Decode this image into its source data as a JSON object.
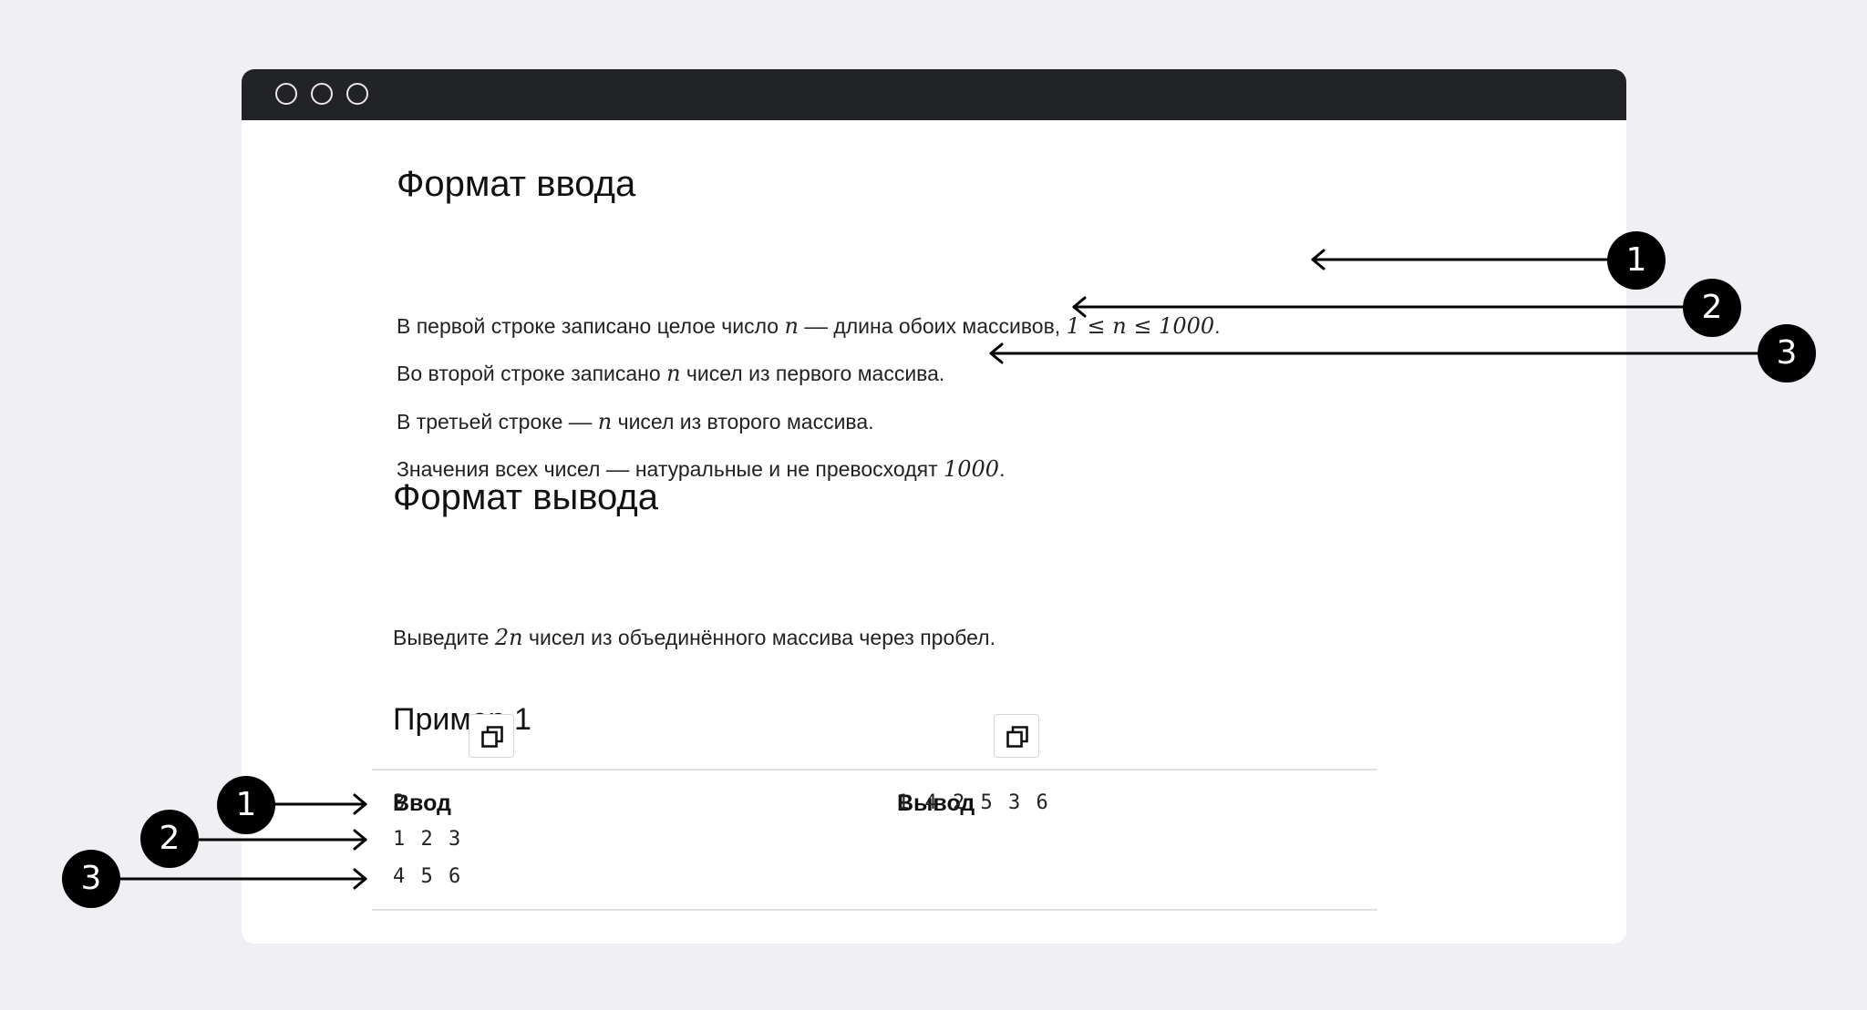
{
  "input_format": {
    "title": "Формат ввода",
    "line1": {
      "a": "В первой строке записано целое число ",
      "var": "n",
      "b": " –– длина обоих массивов, ",
      "constraint": "1 ≤ n ≤ 1000",
      "end": "."
    },
    "line2": {
      "a": "Во второй строке записано ",
      "var": "n",
      "b": " чисел из первого массива."
    },
    "line3": {
      "a": "В третьей строке –– ",
      "var": "n",
      "b": " чисел из второго массива."
    },
    "line4": {
      "a": "Значения всех чисел –– натуральные и не превосходят ",
      "num": "1000",
      "end": "."
    }
  },
  "output_format": {
    "title": "Формат вывода",
    "line1": {
      "a": "Выведите ",
      "expr": "2n",
      "b": " чисел из объединённого массива через пробел."
    }
  },
  "example": {
    "title": "Пример 1",
    "input_label": "Ввод",
    "output_label": "Вывод",
    "input_lines": [
      "3",
      "1 2 3",
      "4 5 6"
    ],
    "output_lines": [
      "1 4 2 5 3 6"
    ]
  },
  "annotations": {
    "right": [
      "1",
      "2",
      "3"
    ],
    "left": [
      "1",
      "2",
      "3"
    ]
  },
  "icons": {
    "copy": "copy-icon",
    "arrow": "arrow-left-icon"
  },
  "colors": {
    "page_bg": "#f0f0f4",
    "titlebar": "#222326",
    "badge": "#000000"
  }
}
